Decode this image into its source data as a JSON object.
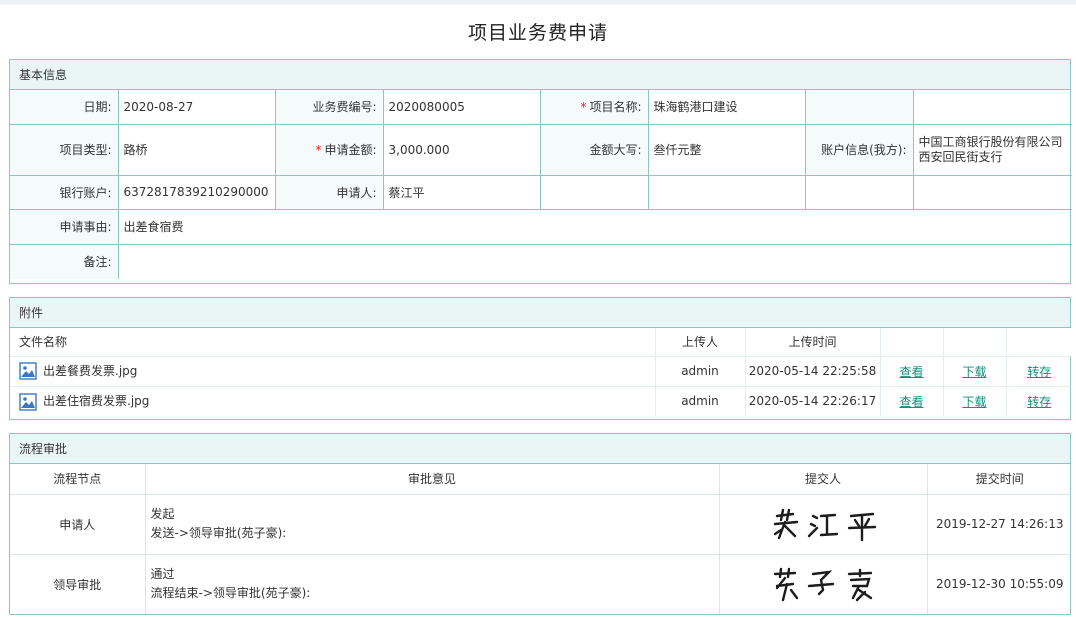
{
  "page": {
    "title": "项目业务费申请"
  },
  "basic": {
    "section_title": "基本信息",
    "date_label": "日期:",
    "date_value": "2020-08-27",
    "fee_no_label": "业务费编号:",
    "fee_no_value": "2020080005",
    "project_name_label": "项目名称:",
    "project_name_value": "珠海鹤港口建设",
    "project_type_label": "项目类型:",
    "project_type_value": "路桥",
    "amount_label": "申请金额:",
    "amount_value": "3,000.000",
    "amount_upper_label": "金额大写:",
    "amount_upper_value": "叁仟元整",
    "account_info_label": "账户信息(我方):",
    "account_info_line1": "中国工商银行股份有限公司",
    "account_info_line2": "西安回民街支行",
    "bank_account_label": "银行账户:",
    "bank_account_value": "6372817839210290000",
    "applicant_label": "申请人:",
    "applicant_value": "蔡江平",
    "reason_label": "申请事由:",
    "reason_value": "出差食宿费",
    "remark_label": "备注:",
    "remark_value": "",
    "required_mark": "*"
  },
  "attachments": {
    "section_title": "附件",
    "headers": {
      "file_name": "文件名称",
      "uploader": "上传人",
      "upload_time": "上传时间"
    },
    "items": [
      {
        "file_name": "出差餐费发票.jpg",
        "uploader": "admin",
        "upload_time": "2020-05-14 22:25:58",
        "view": "查看",
        "download": "下载",
        "save": "转存"
      },
      {
        "file_name": "出差住宿费发票.jpg",
        "uploader": "admin",
        "upload_time": "2020-05-14 22:26:17",
        "view": "查看",
        "download": "下载",
        "save": "转存"
      }
    ],
    "icon": "image-file-icon"
  },
  "flow": {
    "section_title": "流程审批",
    "headers": {
      "node": "流程节点",
      "opinion": "审批意见",
      "submitter": "提交人",
      "time": "提交时间"
    },
    "rows": [
      {
        "node": "申请人",
        "opinion_line1": "发起",
        "opinion_line2": "发送->领导审批(苑子豪):",
        "submitter_signature": "蔡江平",
        "time": "2019-12-27 14:26:13"
      },
      {
        "node": "领导审批",
        "opinion_line1": "通过",
        "opinion_line2": "流程结束->领导审批(苑子豪):",
        "submitter_signature": "苑子豪",
        "time": "2019-12-30 10:55:09"
      }
    ]
  },
  "colors": {
    "border": "#8fc4bf",
    "header_bg": "#eaf6f5",
    "link": "#1a8c7a",
    "required": "#e02020"
  }
}
